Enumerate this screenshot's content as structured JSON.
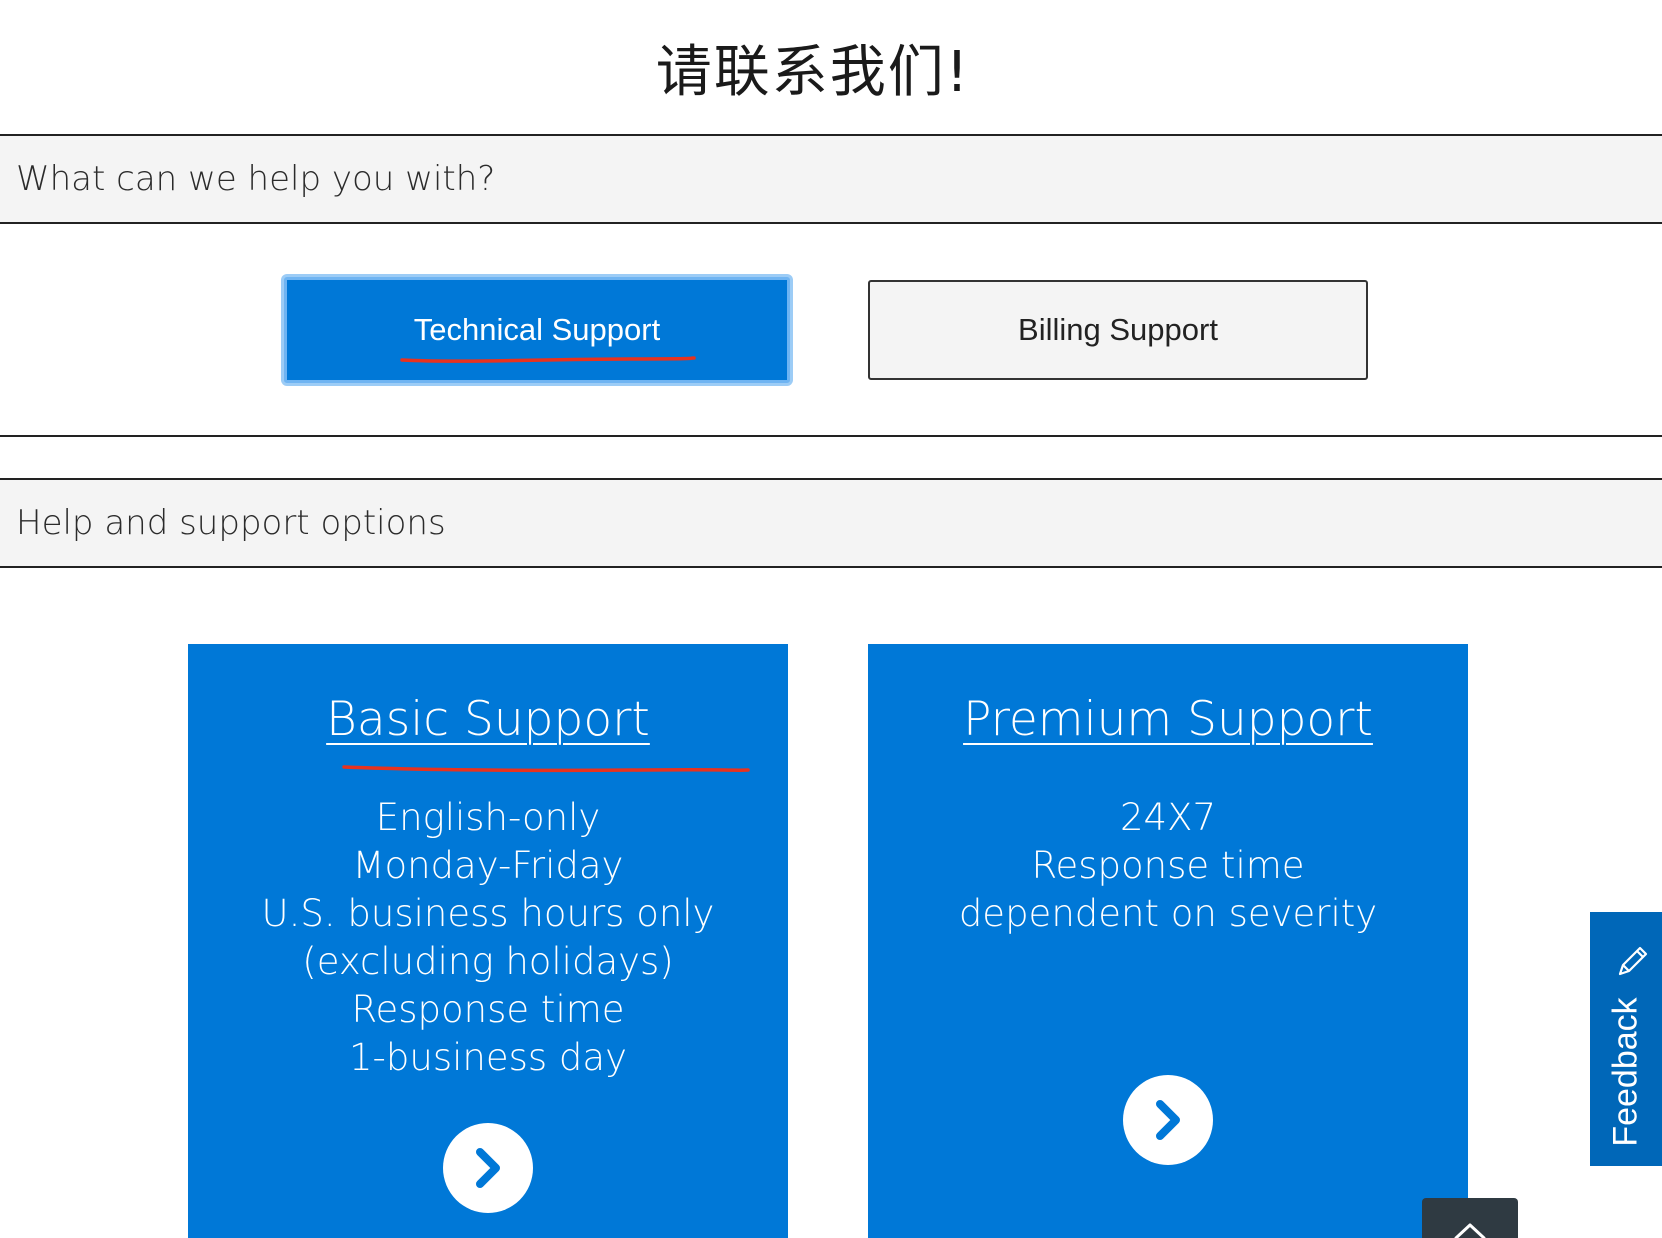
{
  "page": {
    "title": "请联系我们!"
  },
  "help_section": {
    "heading": "What can we help you with?",
    "options": [
      {
        "label": "Technical Support",
        "selected": true
      },
      {
        "label": "Billing Support",
        "selected": false
      }
    ]
  },
  "options_section": {
    "heading": "Help and support options",
    "cards": [
      {
        "title": "Basic Support",
        "lines": [
          "English-only",
          "Monday-Friday",
          "U.S. business hours only",
          "(excluding holidays)",
          "Response time",
          "1-business day"
        ],
        "go_icon": "chevron-right-icon"
      },
      {
        "title": "Premium Support",
        "lines": [
          "24X7",
          "Response time",
          "dependent on severity"
        ],
        "go_icon": "chevron-right-icon"
      }
    ]
  },
  "feedback": {
    "label": "Feedback",
    "icon": "pencil-icon"
  },
  "scroll_top": {
    "icon": "chevron-up-icon"
  },
  "annotations": {
    "color": "#e8321e"
  },
  "colors": {
    "accent": "#0078d7",
    "feedback_bg": "#0067b8",
    "section_bg": "#f4f4f4"
  }
}
